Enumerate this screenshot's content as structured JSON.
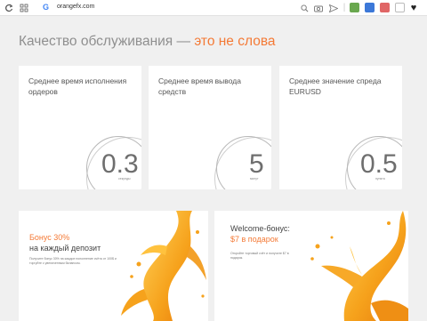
{
  "browser": {
    "url": "orangefx.com",
    "reload_icon": "reload-icon",
    "apps_icon": "apps-grid-icon",
    "google_icon": "G"
  },
  "headline": {
    "text": "Качество обслуживания — ",
    "accent": "это не слова"
  },
  "stats": [
    {
      "title": "Среднее время исполнения ордеров",
      "value": "0.3",
      "unit": "секунды"
    },
    {
      "title": "Среднее время вывода средств",
      "value": "5",
      "unit": "минут"
    },
    {
      "title": "Среднее значение спреда EURUSD",
      "value": "0.5",
      "unit": "пункта"
    }
  ],
  "promos": [
    {
      "line1": "Бонус 30%",
      "line2": "на каждый депозит",
      "small": "Получите бонус 30% на каждое пополнение счёта от 100$ и торгуйте с увеличенным балансом."
    },
    {
      "line1": "Welcome-бонус:",
      "line2": "$7 в подарок",
      "small": "Откройте торговый счёт и получите $7 в подарок."
    }
  ],
  "colors": {
    "accent": "#f47a36",
    "background": "#f0f0f0"
  }
}
